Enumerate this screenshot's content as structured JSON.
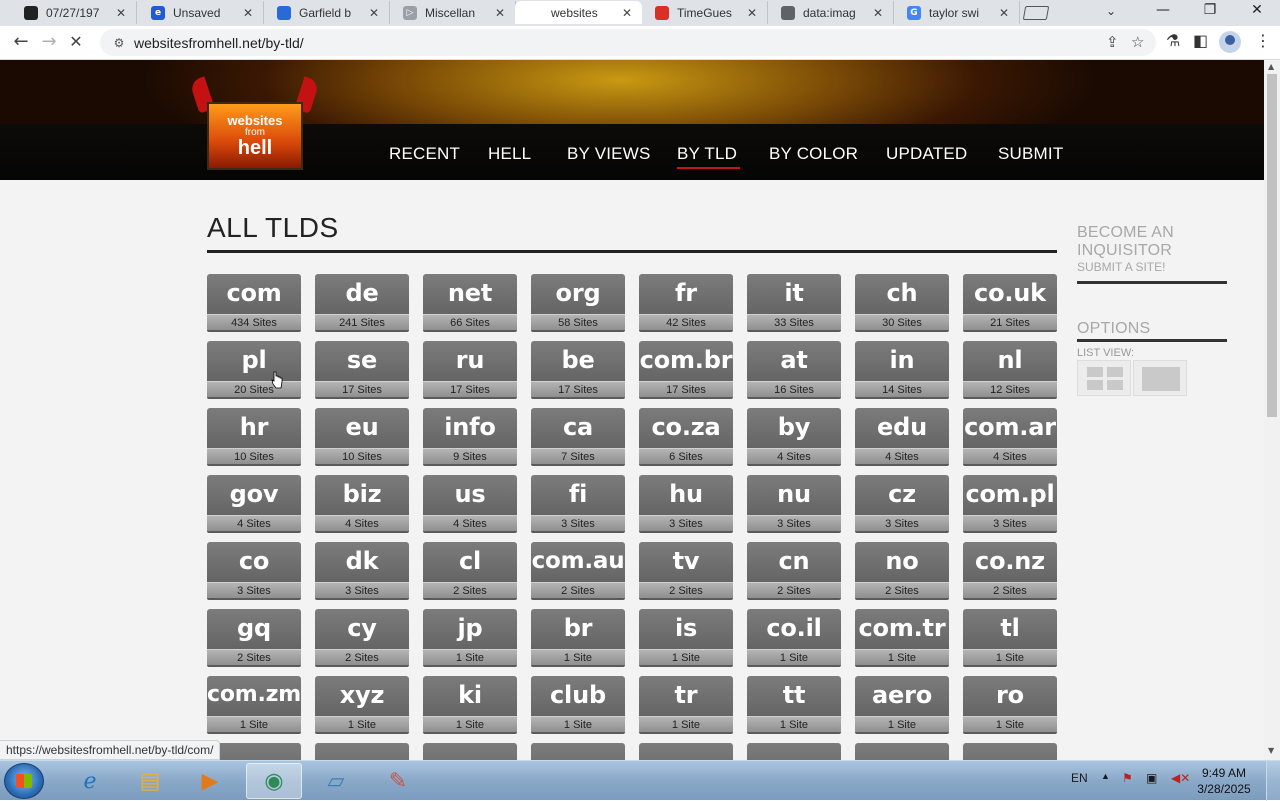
{
  "browser": {
    "tabs": [
      {
        "title": "07/27/197",
        "fav_color": "#222222",
        "fav": ""
      },
      {
        "title": "Unsaved",
        "fav_color": "#1f5bd6",
        "fav": "e"
      },
      {
        "title": "Garfield b",
        "fav_color": "#2a6ad8",
        "fav": ""
      },
      {
        "title": "Miscellan",
        "fav_color": "#9aa0a6",
        "fav": "▷"
      },
      {
        "title": "websites",
        "fav_color": "#ffffff",
        "fav": ""
      },
      {
        "title": "TimeGues",
        "fav_color": "#d93025",
        "fav": ""
      },
      {
        "title": "data:imag",
        "fav_color": "#5f6368",
        "fav": ""
      },
      {
        "title": "taylor swi",
        "fav_color": "#4285f4",
        "fav": "G"
      }
    ],
    "url": "websitesfromhell.net/by-tld/",
    "status_url": "https://websitesfromhell.net/by-tld/com/"
  },
  "site": {
    "logo": {
      "line1": "websites",
      "line2": "from",
      "line3": "hell"
    },
    "nav": [
      "RECENT",
      "HELL",
      "BY VIEWS",
      "BY TLD",
      "BY COLOR",
      "UPDATED",
      "SUBMIT"
    ],
    "active_nav": "BY TLD",
    "heading": "ALL TLDS",
    "tlds": [
      {
        "name": "com",
        "count": "434 Sites"
      },
      {
        "name": "de",
        "count": "241 Sites"
      },
      {
        "name": "net",
        "count": "66 Sites"
      },
      {
        "name": "org",
        "count": "58 Sites"
      },
      {
        "name": "fr",
        "count": "42 Sites"
      },
      {
        "name": "it",
        "count": "33 Sites"
      },
      {
        "name": "ch",
        "count": "30 Sites"
      },
      {
        "name": "co.uk",
        "count": "21 Sites"
      },
      {
        "name": "pl",
        "count": "20 Sites"
      },
      {
        "name": "se",
        "count": "17 Sites"
      },
      {
        "name": "ru",
        "count": "17 Sites"
      },
      {
        "name": "be",
        "count": "17 Sites"
      },
      {
        "name": "com.br",
        "count": "17 Sites"
      },
      {
        "name": "at",
        "count": "16 Sites"
      },
      {
        "name": "in",
        "count": "14 Sites"
      },
      {
        "name": "nl",
        "count": "12 Sites"
      },
      {
        "name": "hr",
        "count": "10 Sites"
      },
      {
        "name": "eu",
        "count": "10 Sites"
      },
      {
        "name": "info",
        "count": "9 Sites"
      },
      {
        "name": "ca",
        "count": "7 Sites"
      },
      {
        "name": "co.za",
        "count": "6 Sites"
      },
      {
        "name": "by",
        "count": "4 Sites"
      },
      {
        "name": "edu",
        "count": "4 Sites"
      },
      {
        "name": "com.ar",
        "count": "4 Sites"
      },
      {
        "name": "gov",
        "count": "4 Sites"
      },
      {
        "name": "biz",
        "count": "4 Sites"
      },
      {
        "name": "us",
        "count": "4 Sites"
      },
      {
        "name": "fi",
        "count": "3 Sites"
      },
      {
        "name": "hu",
        "count": "3 Sites"
      },
      {
        "name": "nu",
        "count": "3 Sites"
      },
      {
        "name": "cz",
        "count": "3 Sites"
      },
      {
        "name": "com.pl",
        "count": "3 Sites"
      },
      {
        "name": "co",
        "count": "3 Sites"
      },
      {
        "name": "dk",
        "count": "3 Sites"
      },
      {
        "name": "cl",
        "count": "2 Sites"
      },
      {
        "name": "com.au",
        "count": "2 Sites"
      },
      {
        "name": "tv",
        "count": "2 Sites"
      },
      {
        "name": "cn",
        "count": "2 Sites"
      },
      {
        "name": "no",
        "count": "2 Sites"
      },
      {
        "name": "co.nz",
        "count": "2 Sites"
      },
      {
        "name": "gq",
        "count": "2 Sites"
      },
      {
        "name": "cy",
        "count": "2 Sites"
      },
      {
        "name": "jp",
        "count": "1 Site"
      },
      {
        "name": "br",
        "count": "1 Site"
      },
      {
        "name": "is",
        "count": "1 Site"
      },
      {
        "name": "co.il",
        "count": "1 Site"
      },
      {
        "name": "com.tr",
        "count": "1 Site"
      },
      {
        "name": "tl",
        "count": "1 Site"
      },
      {
        "name": "com.zm",
        "count": "1 Site"
      },
      {
        "name": "xyz",
        "count": "1 Site"
      },
      {
        "name": "ki",
        "count": "1 Site"
      },
      {
        "name": "club",
        "count": "1 Site"
      },
      {
        "name": "tr",
        "count": "1 Site"
      },
      {
        "name": "tt",
        "count": "1 Site"
      },
      {
        "name": "aero",
        "count": "1 Site"
      },
      {
        "name": "ro",
        "count": "1 Site"
      }
    ],
    "sidebar": {
      "become_line1": "BECOME AN",
      "become_line2": "INQUISITOR",
      "submit_link": "SUBMIT A SITE!",
      "options_title": "OPTIONS",
      "list_view_label": "LIST VIEW:"
    }
  },
  "taskbar": {
    "lang": "EN",
    "time": "9:49 AM",
    "date": "3/28/2025"
  }
}
